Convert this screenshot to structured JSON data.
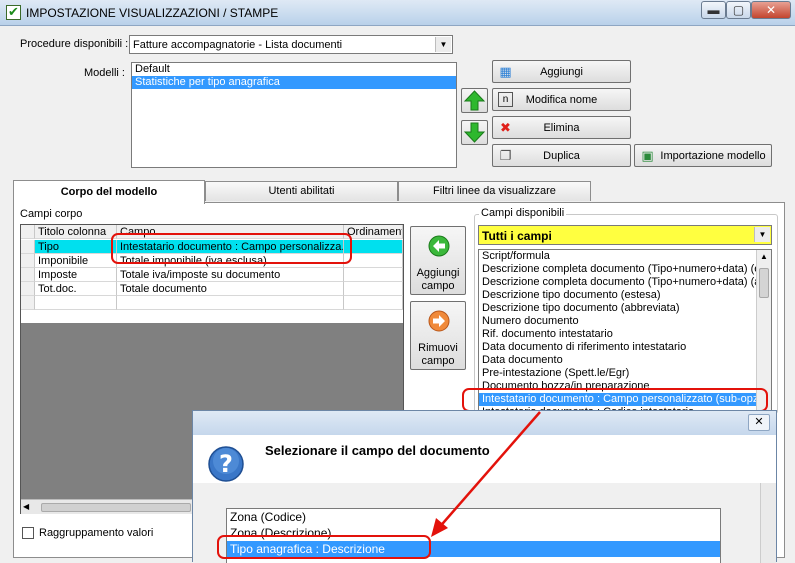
{
  "window": {
    "title": "IMPOSTAZIONE VISUALIZZAZIONI / STAMPE"
  },
  "procedure": {
    "label": "Procedure disponibili :",
    "value": "Fatture accompagnatorie - Lista documenti"
  },
  "modelli": {
    "label": "Modelli :",
    "items": [
      "Default",
      "Statistiche per tipo anagrafica"
    ],
    "selected": 1
  },
  "buttons": {
    "aggiungi": "Aggiungi",
    "modifica": "Modifica nome",
    "elimina": "Elimina",
    "duplica": "Duplica",
    "importa": "Importazione modello"
  },
  "tabs": [
    "Corpo del modello",
    "Utenti abilitati",
    "Filtri linee da visualizzare"
  ],
  "campi_corpo": {
    "label": "Campi corpo",
    "headers": [
      "Titolo colonna",
      "Campo",
      "Ordinamento"
    ],
    "rows": [
      [
        "Tipo",
        "Intestatario documento : Campo personalizza..."
      ],
      [
        "Imponibile",
        "Totale imponibile (iva esclusa)"
      ],
      [
        "Imposte",
        "Totale iva/imposte su documento"
      ],
      [
        "Tot.doc.",
        "Totale documento"
      ]
    ]
  },
  "mid_buttons": {
    "add_line1": "Aggiungi",
    "add_line2": "campo",
    "rem_line1": "Rimuovi",
    "rem_line2": "campo"
  },
  "campi_disponibili": {
    "label": "Campi disponibili",
    "filter": "Tutti i campi",
    "items": [
      "Script/formula",
      "Descrizione completa documento (Tipo+numero+data) (este",
      "Descrizione completa documento (Tipo+numero+data) (abb",
      "Descrizione tipo documento (estesa)",
      "Descrizione tipo documento (abbreviata)",
      "Numero documento",
      "Rif. documento intestatario",
      "Data documento di riferimento intestatario",
      "Data documento",
      "Pre-intestazione (Spett.le/Egr)",
      "Documento bozza/in preparazione",
      "Intestatario documento : Campo personalizzato (sub-opzio",
      "Intestatario documento : Codice intestatario"
    ],
    "selected": 11
  },
  "raggruppamento": {
    "label": "Raggruppamento valori"
  },
  "dialog": {
    "question": "Selezionare il campo del documento",
    "items": [
      "Zona (Codice)",
      "Zona (Descrizione)",
      "Tipo anagrafica : Descrizione"
    ],
    "selected": 2
  },
  "colors": {
    "selection": "#3399ff",
    "highlight_row": "#00e0ee",
    "annotation": "#e3120b",
    "filter_bg": "#ffff40"
  }
}
